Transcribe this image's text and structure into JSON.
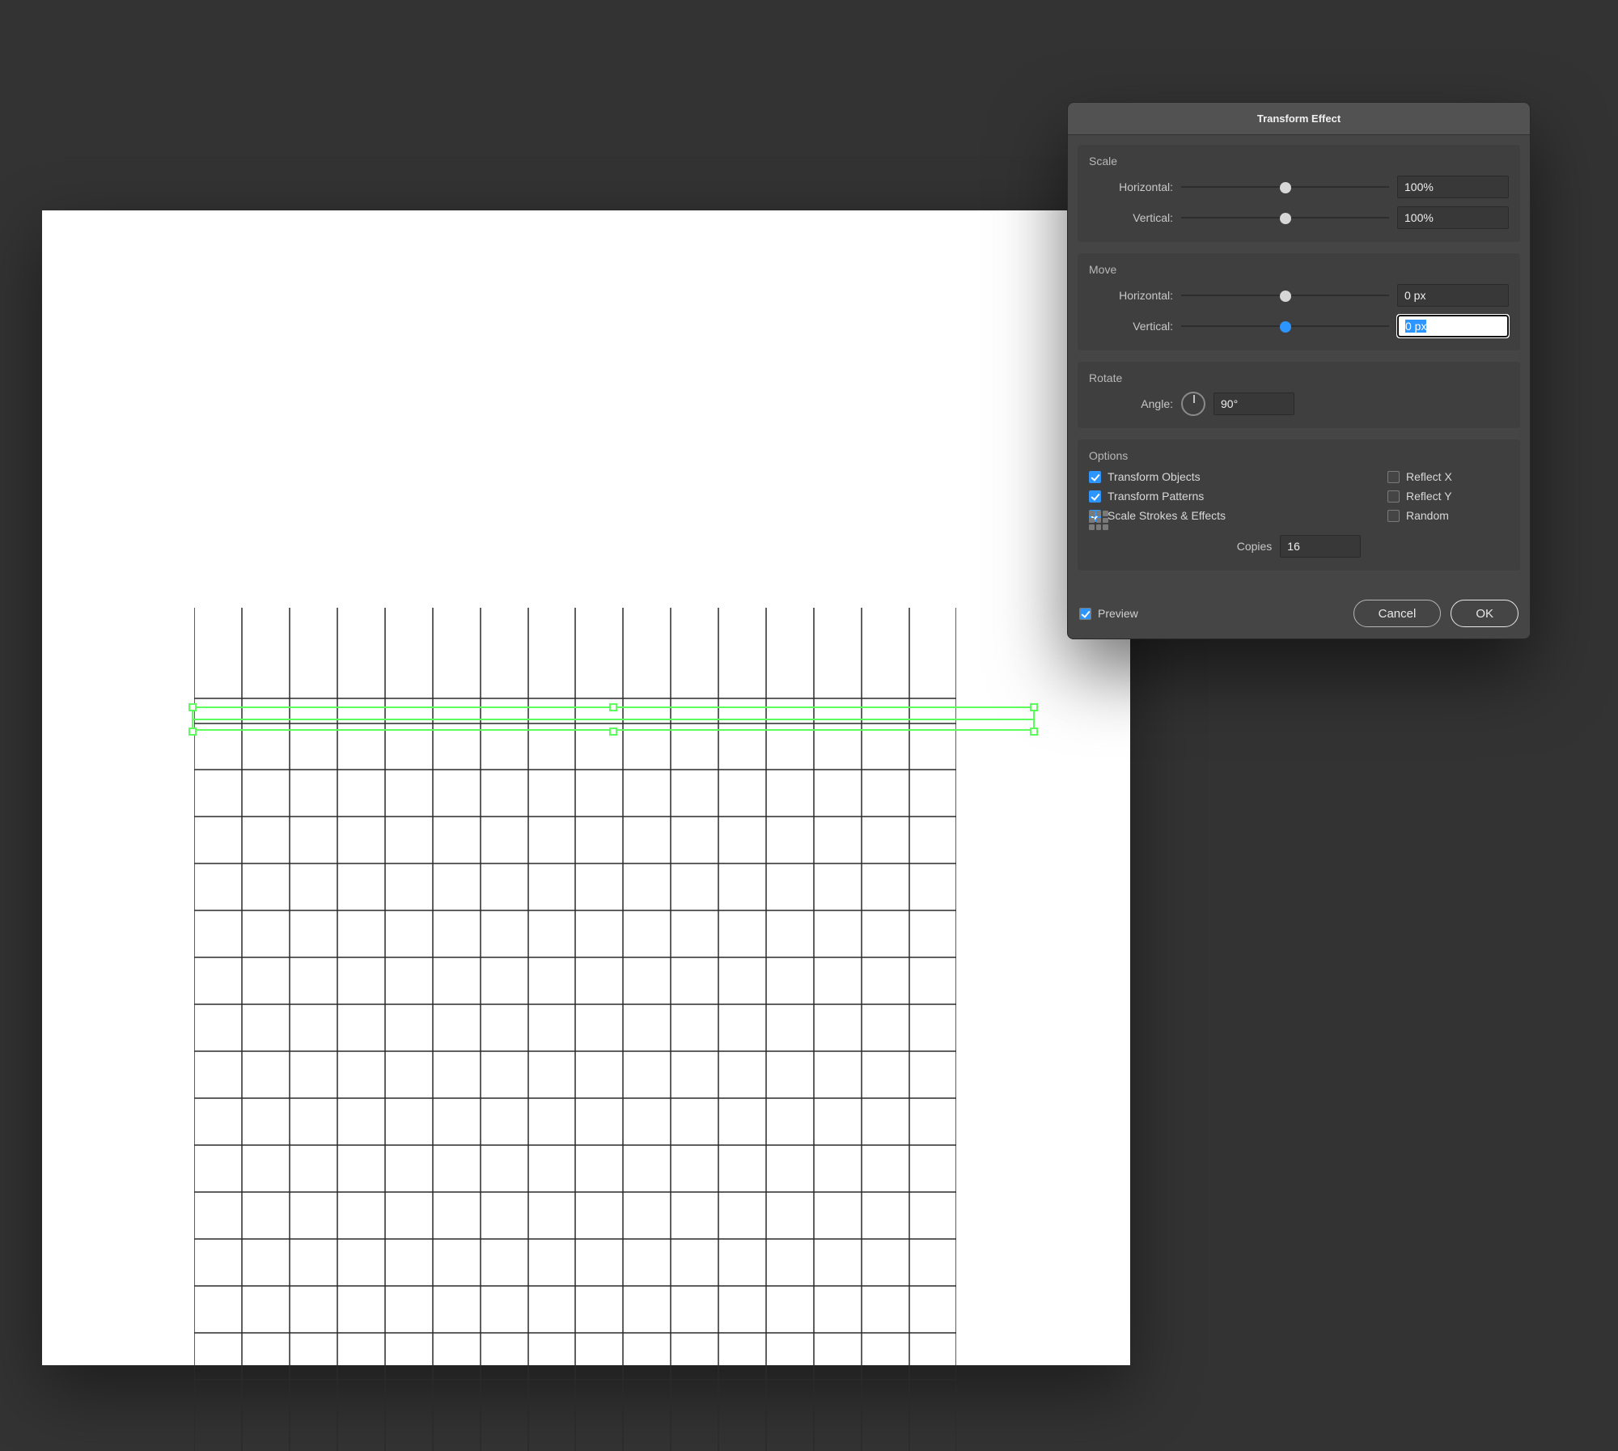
{
  "dialog": {
    "title": "Transform Effect",
    "scale": {
      "title": "Scale",
      "horizontal_label": "Horizontal:",
      "vertical_label": "Vertical:",
      "horizontal_value": "100%",
      "vertical_value": "100%"
    },
    "move": {
      "title": "Move",
      "horizontal_label": "Horizontal:",
      "vertical_label": "Vertical:",
      "horizontal_value": "0 px",
      "vertical_value": "0 px"
    },
    "rotate": {
      "title": "Rotate",
      "angle_label": "Angle:",
      "angle_value": "90°"
    },
    "options": {
      "title": "Options",
      "transform_objects": "Transform Objects",
      "transform_patterns": "Transform Patterns",
      "scale_strokes": "Scale Strokes & Effects",
      "reflect_x": "Reflect X",
      "reflect_y": "Reflect Y",
      "random": "Random",
      "copies_label": "Copies",
      "copies_value": "16"
    },
    "footer": {
      "preview": "Preview",
      "cancel": "Cancel",
      "ok": "OK"
    }
  }
}
